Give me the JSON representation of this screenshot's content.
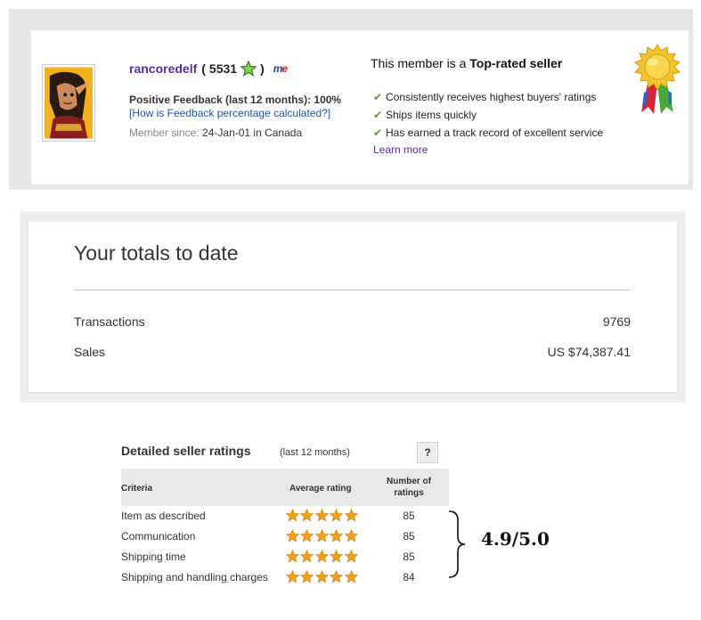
{
  "profile": {
    "username": "rancoredelf",
    "feedback_open": "(",
    "feedback_score": "5531",
    "feedback_close": ")",
    "star_icon": "green-star-icon",
    "me_badge_m": "m",
    "me_badge_e": "e",
    "positive_feedback": "Positive Feedback (last 12 months): 100%",
    "calc_link": "[How is Feedback percentage calculated?]",
    "member_since_label": "Member since:",
    "member_since_value": "24-Jan-01 in Canada",
    "avatar_icon": "elf-avatar"
  },
  "top_rated": {
    "title_prefix": "This member is a",
    "title_bold": "Top-rated seller",
    "items": [
      "Consistently receives highest buyers' ratings",
      "Ships items quickly",
      "Has earned a track record of excellent service"
    ],
    "learn_more": "Learn more",
    "badge_icon": "gold-ribbon-icon",
    "check_color": "#5a9a2e"
  },
  "totals": {
    "title": "Your totals to date",
    "rows": [
      {
        "label": "Transactions",
        "value": "9769"
      },
      {
        "label": "Sales",
        "value": "US $74,387.41"
      }
    ]
  },
  "ratings": {
    "title": "Detailed seller ratings",
    "period": "(last 12 months)",
    "help_label": "?",
    "headers": {
      "criteria": "Criteria",
      "average": "Average rating",
      "number": "Number of ratings"
    },
    "rows": [
      {
        "criteria": "Item as described",
        "stars": 5,
        "count": "85"
      },
      {
        "criteria": "Communication",
        "stars": 5,
        "count": "85"
      },
      {
        "criteria": "Shipping time",
        "stars": 5,
        "count": "85"
      },
      {
        "criteria": "Shipping and handling charges",
        "stars": 5,
        "count": "84"
      }
    ],
    "overall": "4.9/5.0",
    "star_color": "#f5a01a"
  }
}
